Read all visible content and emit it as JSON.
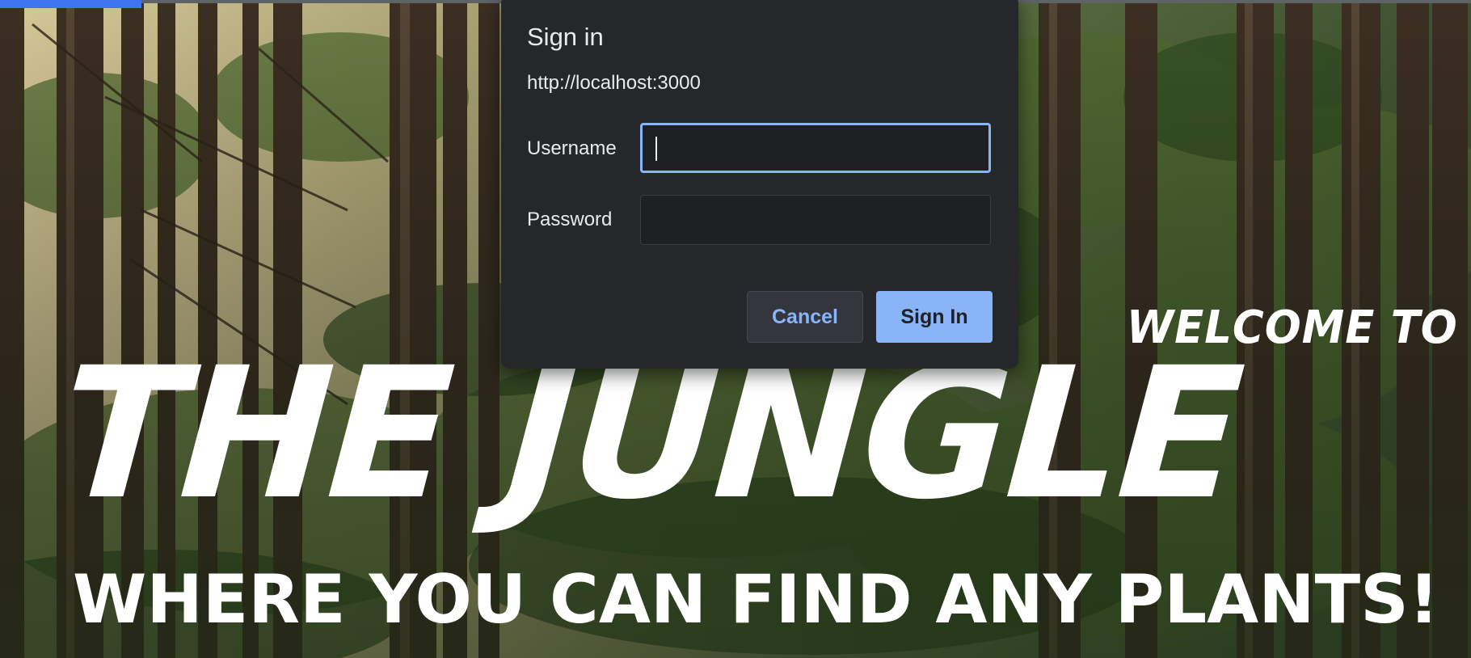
{
  "browser": {
    "loading_bar_color": "#3e74ee"
  },
  "dialog": {
    "title": "Sign in",
    "origin": "http://localhost:3000",
    "username_label": "Username",
    "username_value": "",
    "password_label": "Password",
    "password_value": "",
    "cancel_label": "Cancel",
    "signin_label": "Sign In",
    "colors": {
      "background": "#26272b",
      "accent": "#8ab4f8",
      "text": "#e8eaed"
    }
  },
  "hero": {
    "welcome": "WELCOME TO",
    "title": "THE JUNGLE",
    "subtitle": "WHERE YOU CAN FIND ANY PLANTS!",
    "background_image": "forest-photo"
  }
}
